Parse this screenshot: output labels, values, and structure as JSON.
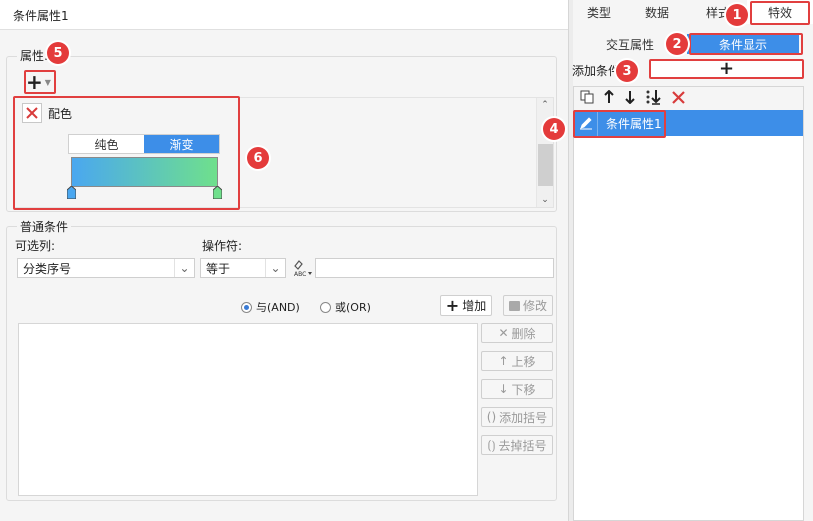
{
  "left": {
    "title": "条件属性1",
    "attr_section": {
      "legend": "属性:",
      "add_symbol": "+",
      "color_item_label": "配色",
      "solid_label": "纯色",
      "gradient_label": "渐变"
    },
    "cond_section": {
      "legend": "普通条件",
      "col_label": "可选列:",
      "op_label": "操作符:",
      "col_value": "分类序号",
      "op_value": "等于",
      "value_input": "",
      "and_label": "与(AND)",
      "or_label": "或(OR)",
      "add_button": "增加",
      "modify_button": "修改",
      "delete_button": "删除",
      "up_button": "上移",
      "down_button": "下移",
      "add_bracket_button": "添加括号",
      "remove_bracket_button": "去掉括号",
      "logic_selected": "AND"
    }
  },
  "right": {
    "tabs": [
      "类型",
      "数据",
      "样式",
      "特效"
    ],
    "active_tab": "特效",
    "subtabs": [
      "交互属性",
      "条件显示"
    ],
    "active_subtab": "条件显示",
    "add_condition_label": "添加条件",
    "add_symbol": "+",
    "list_items": [
      {
        "label": "条件属性1",
        "selected": true
      }
    ]
  },
  "badges": [
    "1",
    "2",
    "3",
    "4",
    "5",
    "6"
  ],
  "colors": {
    "accent": "#3d8ee8",
    "badge": "#e43b3b",
    "gradient_start": "#4aa7f0",
    "gradient_end": "#6fe08c",
    "delete_red": "#d83b3b"
  },
  "icons": [
    "copy-icon",
    "arrow-up-icon",
    "arrow-down-icon",
    "move-bottom-icon",
    "delete-x-icon",
    "edit-pencil-icon",
    "bracket-icon",
    "formula-icon"
  ]
}
